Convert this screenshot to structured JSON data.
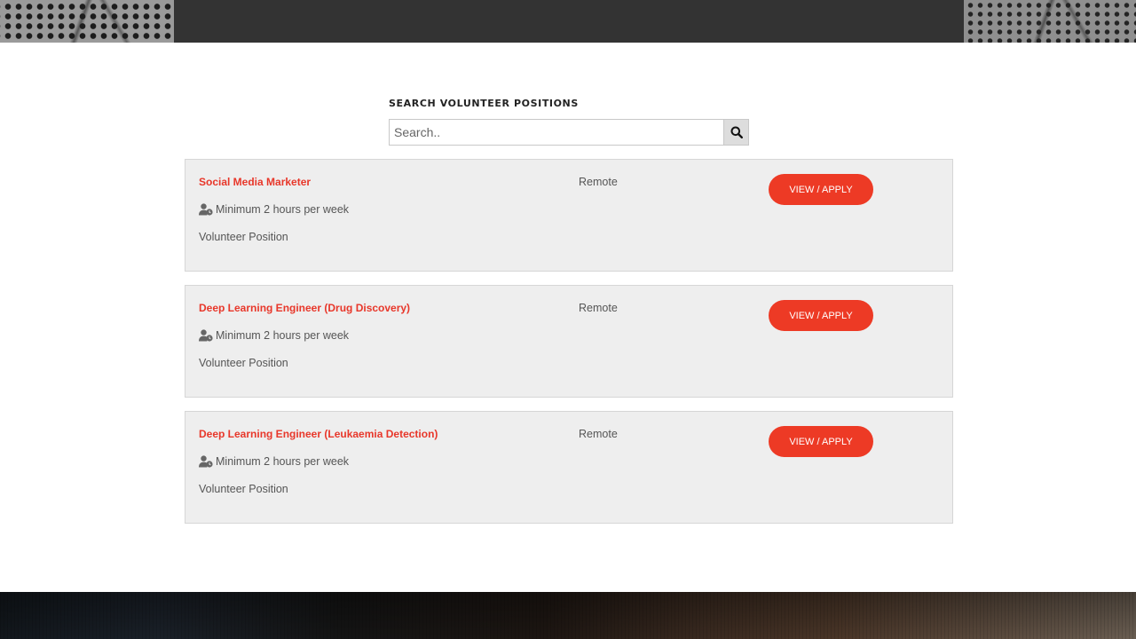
{
  "search": {
    "title": "SEARCH VOLUNTEER POSITIONS",
    "placeholder": "Search..",
    "button_icon": "search-icon"
  },
  "positions": [
    {
      "title": "Social Media Marketer",
      "hours": "Minimum 2 hours per week",
      "type": "Volunteer Position",
      "location": "Remote",
      "button_label": "VIEW / APPLY"
    },
    {
      "title": "Deep Learning Engineer (Drug Discovery)",
      "hours": "Minimum 2 hours per week",
      "type": "Volunteer Position",
      "location": "Remote",
      "button_label": "VIEW / APPLY"
    },
    {
      "title": "Deep Learning Engineer (Leukaemia Detection)",
      "hours": "Minimum 2 hours per week",
      "type": "Volunteer Position",
      "location": "Remote",
      "button_label": "VIEW / APPLY"
    }
  ],
  "colors": {
    "accent": "#ed3a25",
    "title_link": "#e8372a",
    "card_background": "#eeeeee",
    "header_background": "#333333"
  },
  "icons": {
    "hours": "user-clock-icon",
    "search": "search-icon"
  }
}
